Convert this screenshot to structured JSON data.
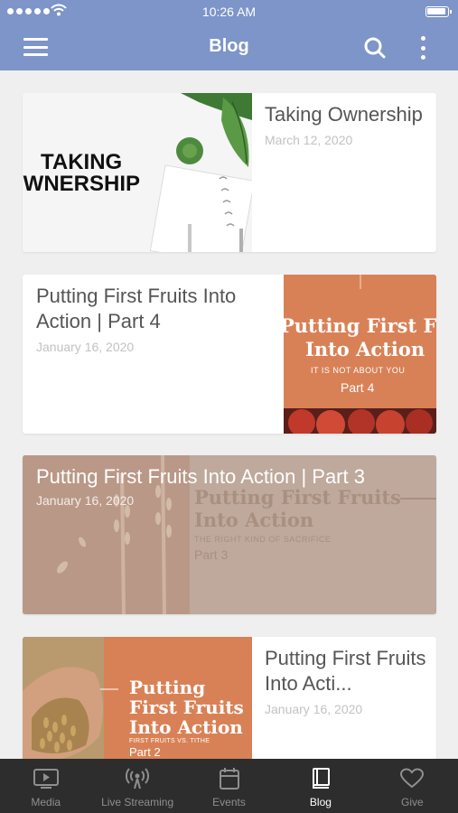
{
  "status_bar": {
    "time": "10:26 AM"
  },
  "header": {
    "title": "Blog"
  },
  "posts": [
    {
      "title": "Taking Ownership",
      "date": "March 12, 2020",
      "image_lines": [
        "TAKING",
        "OWNERSHIP"
      ]
    },
    {
      "title": "Putting First Fruits Into Action | Part 4",
      "date": "January 16, 2020",
      "image_title": [
        "Putting First Fruits",
        "Into Action"
      ],
      "image_subtitle": "IT IS NOT ABOUT YOU",
      "image_part": "Part 4"
    },
    {
      "title": "Putting First Fruits Into Action | Part 3",
      "date": "January 16, 2020",
      "image_title": [
        "Putting First Fruits",
        "Into Action"
      ],
      "image_subtitle": "THE RIGHT KIND OF SACRIFICE",
      "image_part": "Part 3"
    },
    {
      "title": "Putting First Fruits Into Acti...",
      "date": "January 16, 2020",
      "image_title": [
        "Putting",
        "First Fruits",
        "Into Action"
      ],
      "image_subtitle": "FIRST FRUITS VS. TITHE",
      "image_part": "Part 2"
    }
  ],
  "tabs": [
    {
      "label": "Media",
      "icon": "tv-play-icon",
      "active": false
    },
    {
      "label": "Live Streaming",
      "icon": "broadcast-icon",
      "active": false
    },
    {
      "label": "Events",
      "icon": "calendar-icon",
      "active": false
    },
    {
      "label": "Blog",
      "icon": "book-icon",
      "active": true
    },
    {
      "label": "Give",
      "icon": "heart-icon",
      "active": false
    }
  ],
  "colors": {
    "header": "#7d95c8",
    "tab_bar": "#2d2d2d",
    "post_accent": "#d98156"
  }
}
